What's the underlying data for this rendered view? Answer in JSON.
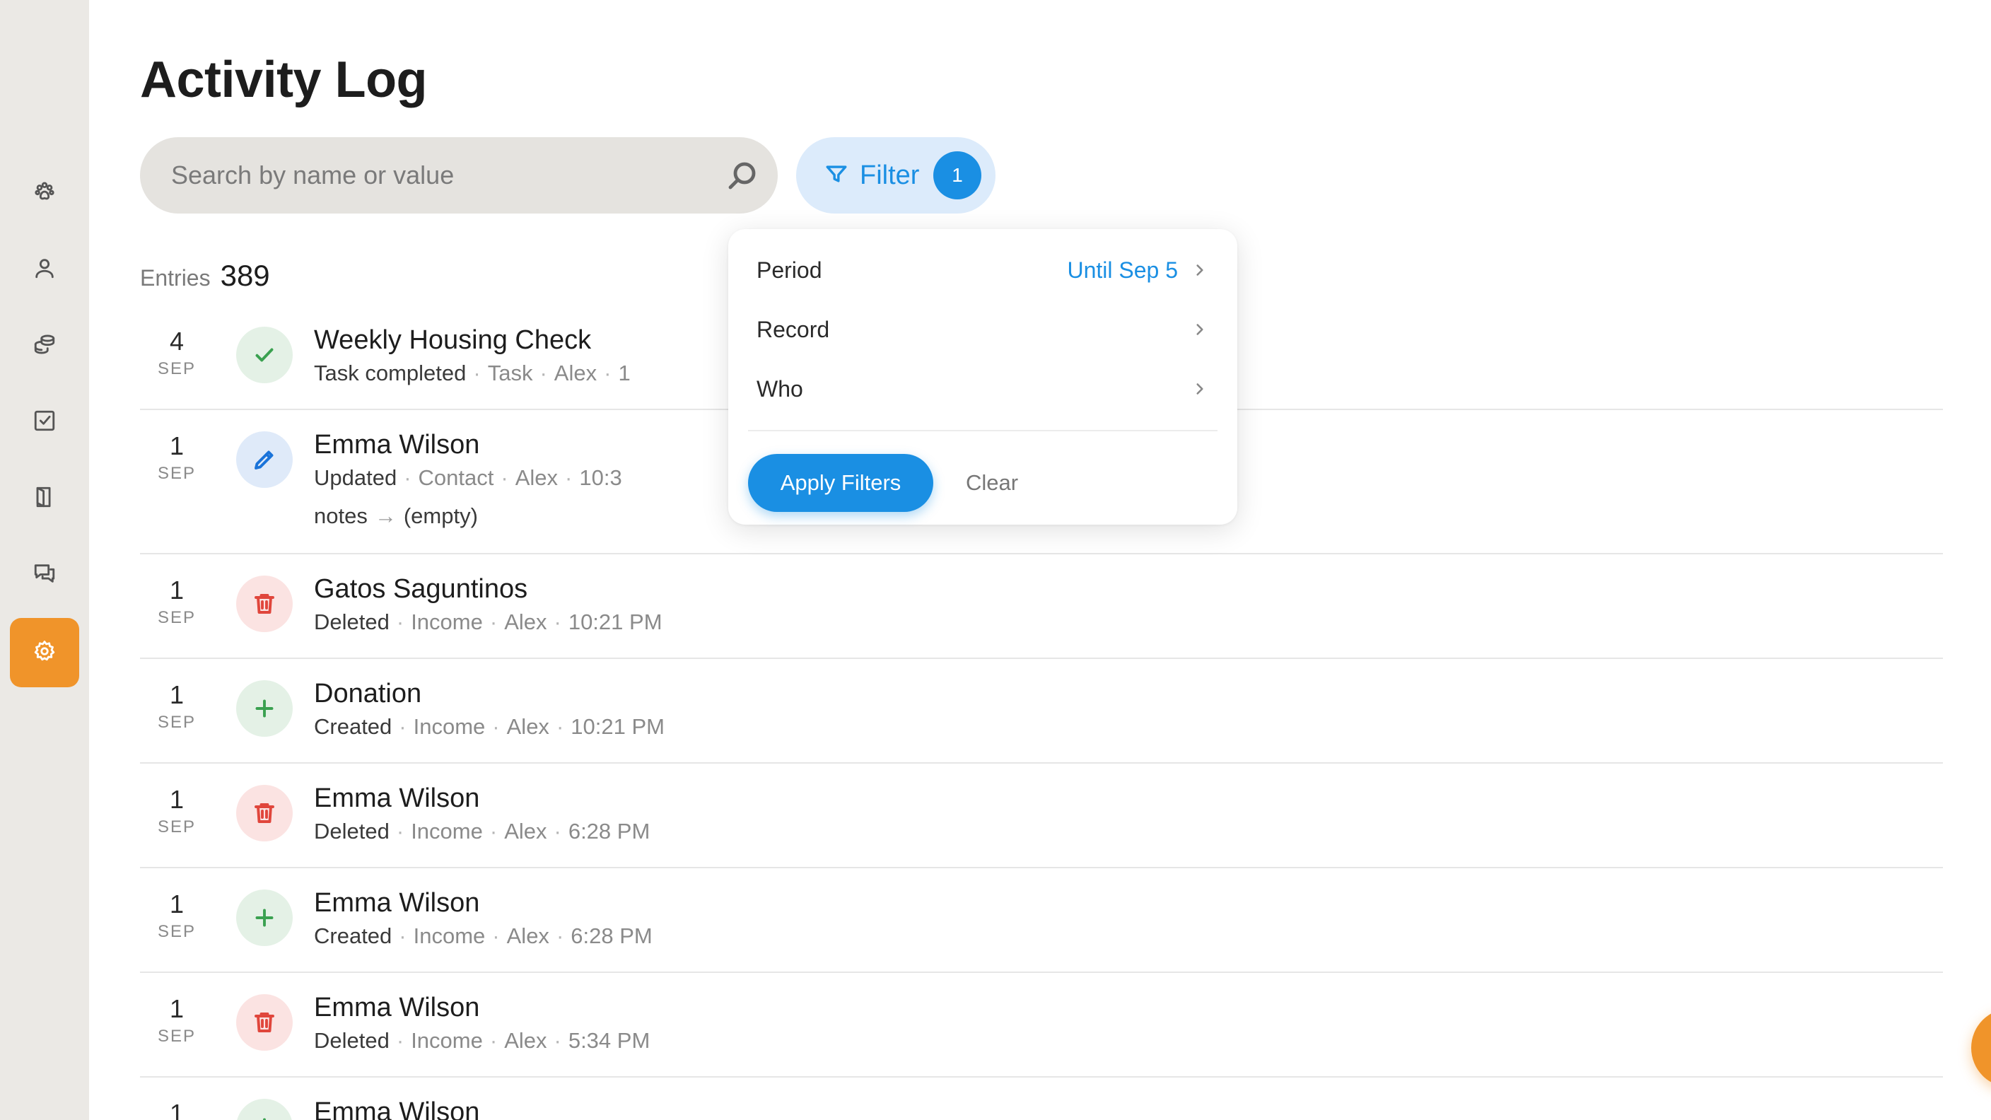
{
  "page": {
    "title": "Activity Log"
  },
  "sidebar": {
    "items": [
      {
        "name": "paw-icon",
        "active": false
      },
      {
        "name": "person-icon",
        "active": false
      },
      {
        "name": "coins-icon",
        "active": false
      },
      {
        "name": "checkbox-icon",
        "active": false
      },
      {
        "name": "book-icon",
        "active": false
      },
      {
        "name": "chat-icon",
        "active": false
      },
      {
        "name": "gear-icon",
        "active": true
      }
    ]
  },
  "search": {
    "placeholder": "Search by name or value"
  },
  "filter": {
    "label": "Filter",
    "badge": "1"
  },
  "entries": {
    "label": "Entries",
    "count": "389"
  },
  "rows": [
    {
      "day": "4",
      "month": "SEP",
      "icon": "check-icon",
      "title": "Weekly Housing Check",
      "action": "Task completed",
      "type": "Task",
      "user": "Alex",
      "time": "1"
    },
    {
      "day": "1",
      "month": "SEP",
      "icon": "pencil-icon",
      "title": "Emma Wilson",
      "action": "Updated",
      "type": "Contact",
      "user": "Alex",
      "time": "10:3",
      "change_field": "notes",
      "change_arrow": "→",
      "change_value": "(empty)"
    },
    {
      "day": "1",
      "month": "SEP",
      "icon": "trash-icon",
      "title": "Gatos Saguntinos",
      "action": "Deleted",
      "type": "Income",
      "user": "Alex",
      "time": "10:21 PM"
    },
    {
      "day": "1",
      "month": "SEP",
      "icon": "plus-icon",
      "title": "Donation",
      "action": "Created",
      "type": "Income",
      "user": "Alex",
      "time": "10:21 PM"
    },
    {
      "day": "1",
      "month": "SEP",
      "icon": "trash-icon",
      "title": "Emma Wilson",
      "action": "Deleted",
      "type": "Income",
      "user": "Alex",
      "time": "6:28 PM"
    },
    {
      "day": "1",
      "month": "SEP",
      "icon": "plus-icon",
      "title": "Emma Wilson",
      "action": "Created",
      "type": "Income",
      "user": "Alex",
      "time": "6:28 PM"
    },
    {
      "day": "1",
      "month": "SEP",
      "icon": "trash-icon",
      "title": "Emma Wilson",
      "action": "Deleted",
      "type": "Income",
      "user": "Alex",
      "time": "5:34 PM"
    },
    {
      "day": "1",
      "icon": "plus-icon",
      "title": "Emma Wilson"
    }
  ],
  "popover": {
    "period_label": "Period",
    "period_value": "Until Sep 5",
    "record_label": "Record",
    "who_label": "Who",
    "apply_label": "Apply Filters",
    "clear_label": "Clear"
  },
  "fab": {
    "icon": "search-icon"
  },
  "colors": {
    "accent": "#f0942a",
    "primary": "#1a8fe3",
    "success": "#3aa150",
    "danger": "#e0463c"
  }
}
